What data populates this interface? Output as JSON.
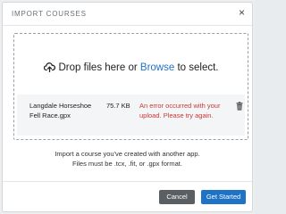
{
  "modal": {
    "title": "IMPORT COURSES",
    "close_label": "×"
  },
  "dropzone": {
    "text_before": "Drop files here or ",
    "browse_label": "Browse",
    "text_after": " to select.",
    "icon": "cloud-upload-icon"
  },
  "file": {
    "name": "Langdale Horseshoe Fell Race.gpx",
    "size": "75.7 KB",
    "error": "An error occurred with your upload. Please try again.",
    "delete_icon": "trash-icon"
  },
  "info": {
    "line1": "Import a course you've created with another app.",
    "line2": "Files must be .tcx, .fit, or .gpx format."
  },
  "footer": {
    "cancel_label": "Cancel",
    "submit_label": "Get Started"
  },
  "colors": {
    "accent": "#1f73c7",
    "error": "#c93838",
    "cancel_bg": "#5a5f63"
  }
}
